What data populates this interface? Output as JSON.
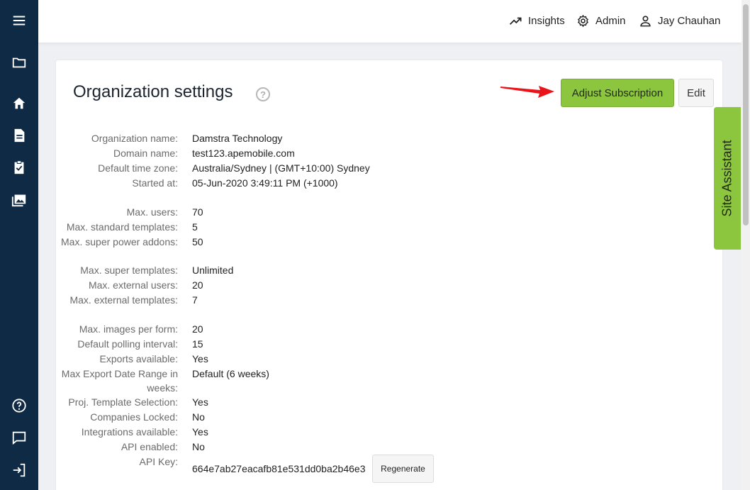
{
  "topbar": {
    "insights": "Insights",
    "admin": "Admin",
    "user": "Jay Chauhan"
  },
  "sidebar": {
    "icons": [
      "menu-icon",
      "folder-icon",
      "home-icon",
      "document-icon",
      "clipboard-check-icon",
      "images-icon",
      "help-icon",
      "chat-icon",
      "logout-icon"
    ]
  },
  "page": {
    "title": "Organization settings",
    "help_glyph": "?",
    "adjust_label": "Adjust Subscription",
    "edit_label": "Edit",
    "site_assistant": "Site Assistant"
  },
  "details": [
    {
      "label": "Organization name:",
      "value": "Damstra Technology"
    },
    {
      "label": "Domain name:",
      "value": "test123.apemobile.com"
    },
    {
      "label": "Default time zone:",
      "value": "Australia/Sydney | (GMT+10:00) Sydney"
    },
    {
      "label": "Started at:",
      "value": "05-Jun-2020 3:49:11 PM (+1000)"
    },
    {
      "label": "Max. users:",
      "value": "70"
    },
    {
      "label": "Max. standard templates:",
      "value": "5"
    },
    {
      "label": "Max. super power addons:",
      "value": "50"
    },
    {
      "label": "Max. super templates:",
      "value": "Unlimited"
    },
    {
      "label": "Max. external users:",
      "value": "20"
    },
    {
      "label": "Max. external templates:",
      "value": "7"
    },
    {
      "label": "Max. images per form:",
      "value": "20"
    },
    {
      "label": "Default polling interval:",
      "value": "15"
    },
    {
      "label": "Exports available:",
      "value": "Yes"
    },
    {
      "label": "Max Export Date Range in weeks:",
      "value": "Default (6 weeks)"
    },
    {
      "label": "Proj. Template Selection:",
      "value": "Yes"
    },
    {
      "label": "Companies Locked:",
      "value": "No"
    },
    {
      "label": "Integrations available:",
      "value": "Yes"
    },
    {
      "label": "API enabled:",
      "value": "No"
    },
    {
      "label": "API Key:",
      "value": "664e7ab27eacafb81e531dd0ba2b46e3"
    }
  ],
  "regenerate_label": "Regenerate",
  "colors": {
    "sidebar": "#0f2a44",
    "accent_green": "#8cc63f",
    "arrow_red": "#e8141a"
  }
}
